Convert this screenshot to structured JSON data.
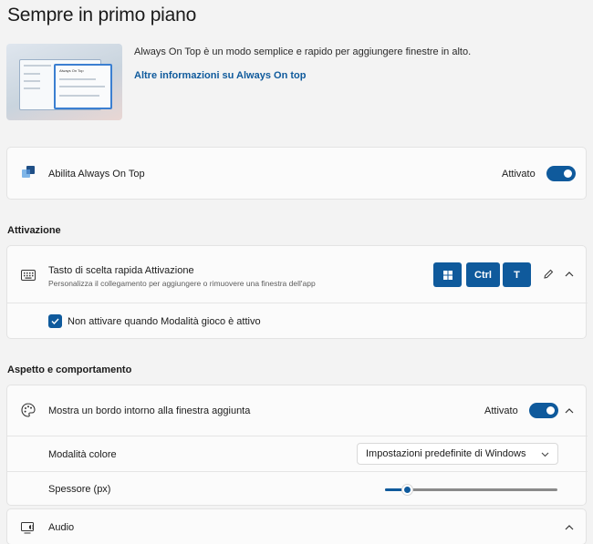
{
  "page": {
    "title": "Sempre in primo piano"
  },
  "hero": {
    "description": "Always On Top è un modo semplice e rapido per aggiungere finestre in alto.",
    "link": "Altre informazioni su Always On top",
    "mini_window_title": "Always On Top"
  },
  "enable": {
    "label": "Abilita Always On Top",
    "state": "Attivato",
    "on": true,
    "icon": "always-on-top-app-icon"
  },
  "activation": {
    "section_title": "Attivazione",
    "shortcut_label": "Tasto di scelta rapida Attivazione",
    "shortcut_desc": "Personalizza il collegamento per aggiungere o rimuovere una finestra dell'app",
    "keys": [
      "⊞",
      "Ctrl",
      "T"
    ],
    "game_mode_label": "Non attivare quando Modalità gioco è attivo",
    "game_mode_checked": true
  },
  "appearance": {
    "section_title": "Aspetto e comportamento",
    "border_label": "Mostra un bordo intorno alla finestra aggiunta",
    "border_state": "Attivato",
    "border_on": true,
    "color_mode_label": "Modalità colore",
    "color_mode_value": "Impostazioni predefinite di Windows",
    "thickness_label": "Spessore (px)",
    "thickness_fraction": 0.13,
    "audio_label": "Audio"
  },
  "colors": {
    "accent": "#0f5a9c",
    "background": "#f3f3f3",
    "card": "#fbfbfb"
  }
}
